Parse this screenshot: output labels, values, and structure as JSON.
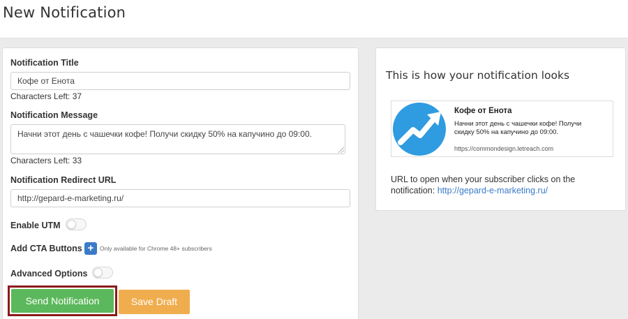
{
  "page": {
    "title": "New Notification"
  },
  "form": {
    "title_label": "Notification Title",
    "title_value": "Кофе от Енота",
    "title_chars_left": "Characters Left: 37",
    "message_label": "Notification Message",
    "message_value": "Начни этот день с чашечки кофе! Получи скидку 50% на капучино до 09:00.",
    "message_chars_left": "Characters Left: 33",
    "url_label": "Notification Redirect URL",
    "url_value": "http://gepard-e-marketing.ru/",
    "utm_label": "Enable UTM",
    "utm_enabled": false,
    "cta_label": "Add CTA Buttons",
    "cta_icon": "plus-icon",
    "cta_note": "Only available for Chrome 48+ subscribers",
    "advanced_label": "Advanced Options",
    "advanced_enabled": false,
    "send_label": "Send Notification",
    "draft_label": "Save Draft"
  },
  "preview": {
    "heading": "This is how your notification looks",
    "notif_title": "Кофе от Енота",
    "notif_body": "Начни этот день с чашечки кофе! Получи скидку 50% на капучино до 09:00.",
    "notif_site": "https://commondesign.letreach.com",
    "url_line1": "URL to open when your subscriber clicks on the",
    "url_line2_prefix": "notification: ",
    "url_link": "http://gepard-e-marketing.ru/",
    "logo_icon": "trending-up-icon"
  },
  "colors": {
    "send_button": "#5cb85c",
    "draft_button": "#f0ad4e",
    "send_highlight_border": "#8b1a1a",
    "cta_button": "#3a7bc8",
    "logo_circle": "#2f9be0"
  }
}
